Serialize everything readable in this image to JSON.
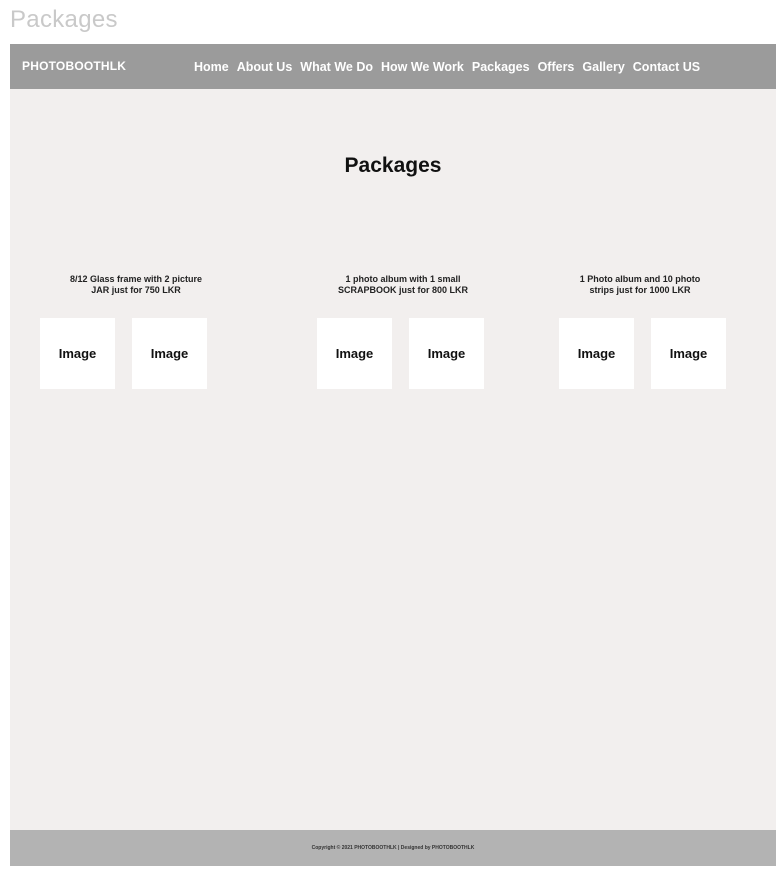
{
  "frame": {
    "label": "Packages"
  },
  "navbar": {
    "brand": "PHOTOBOOTHLK",
    "links": [
      {
        "label": "Home"
      },
      {
        "label": "About Us"
      },
      {
        "label": "What We Do"
      },
      {
        "label": "How We Work"
      },
      {
        "label": "Packages"
      },
      {
        "label": "Offers"
      },
      {
        "label": "Gallery"
      },
      {
        "label": "Contact US"
      }
    ]
  },
  "main": {
    "title": "Packages",
    "packages": [
      {
        "line1": "8/12 Glass frame with 2 picture",
        "line2": "JAR just for 750 LKR",
        "images": [
          "Image",
          "Image"
        ]
      },
      {
        "line1": "1 photo album with 1 small",
        "line2": "SCRAPBOOK just for 800 LKR",
        "images": [
          "Image",
          "Image"
        ]
      },
      {
        "line1": "1 Photo album and 10 photo",
        "line2": "strips just for 1000 LKR",
        "images": [
          "Image",
          "Image"
        ]
      }
    ]
  },
  "footer": {
    "text": "Copyright © 2021 PHOTOBOOTHLK | Designed by PHOTOBOOTHLK"
  },
  "colors": {
    "navbar": "#9b9b9b",
    "page_background": "#f2efee",
    "footer": "#b3b3b3"
  }
}
